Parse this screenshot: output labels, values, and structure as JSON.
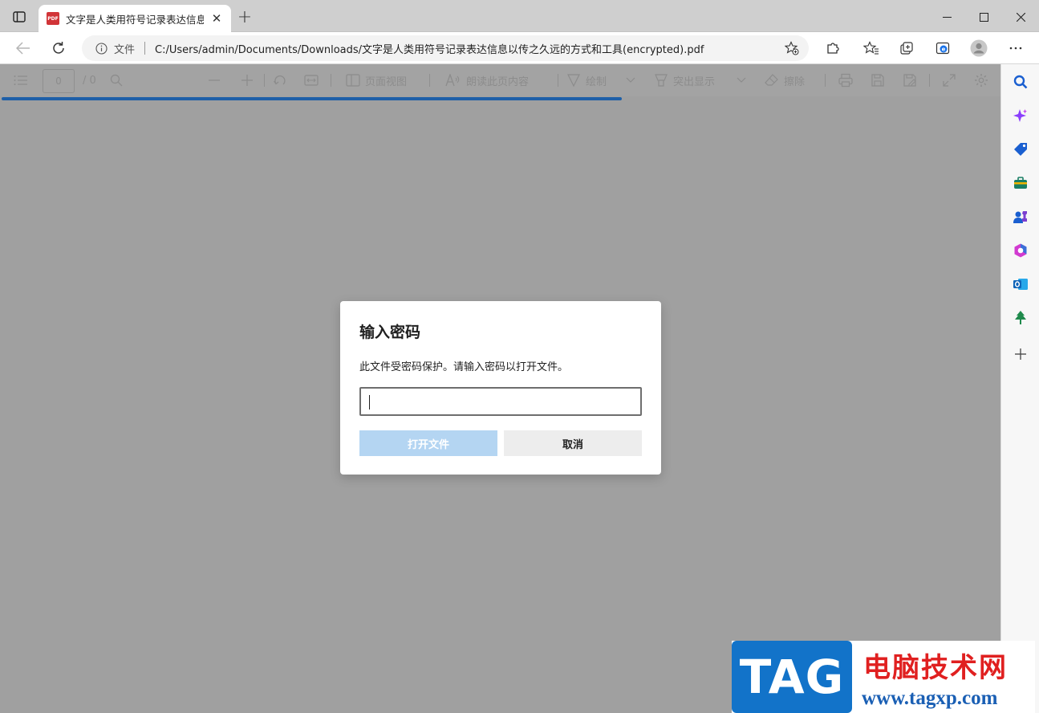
{
  "browser": {
    "tab_title": "文字是人类用符号记录表达信息以传之久远的方式和工具(encrypted).pdf",
    "tab_icon_text": "PDF",
    "address_label": "文件",
    "url": "C:/Users/admin/Documents/Downloads/文字是人类用符号记录表达信息以传之久远的方式和工具(encrypted).pdf"
  },
  "pdf_toolbar": {
    "page_number": "0",
    "page_total": "/ 0",
    "page_view_label": "页面视图",
    "read_aloud_label": "朗读此页内容",
    "draw_label": "绘制",
    "highlight_label": "突出显示",
    "erase_label": "擦除"
  },
  "loading": {
    "progress": 0.62,
    "color": "#1e5fa8"
  },
  "dialog": {
    "title": "输入密码",
    "message": "此文件受密码保护。请输入密码以打开文件。",
    "password_value": "",
    "open_button": "打开文件",
    "cancel_button": "取消",
    "open_button_color": "#b4d5f2"
  },
  "sidebar": {
    "items": [
      "search-icon",
      "copilot-icon",
      "shopping-tag-icon",
      "tools-icon",
      "games-icon",
      "office-icon",
      "outlook-icon",
      "tree-icon",
      "add-icon"
    ]
  },
  "watermark": {
    "logo_text": "TAG",
    "site_name": "电脑技术网",
    "site_url": "www.tagxp.com"
  }
}
